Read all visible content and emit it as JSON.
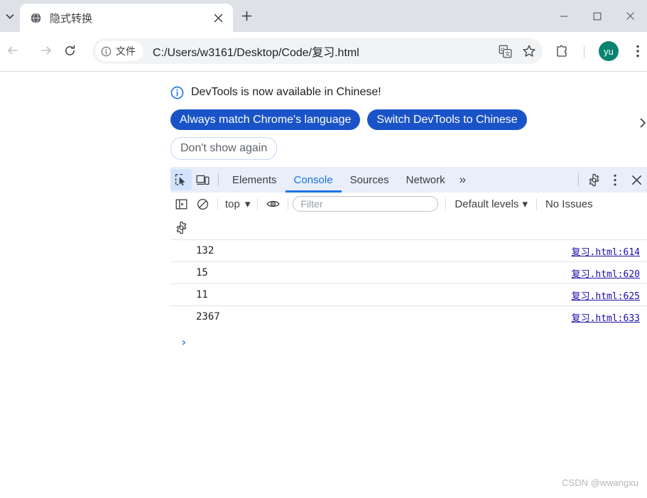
{
  "window": {
    "tab_search_icon": "chevron-down-icon",
    "minimize_label": "—",
    "maximize_label": "▢",
    "close_label": "✕"
  },
  "tab": {
    "title": "隐式转换",
    "favicon": "globe-icon",
    "close_icon": "close-icon",
    "new_tab_icon": "plus-icon"
  },
  "toolbar": {
    "back_icon": "arrow-left-icon",
    "forward_icon": "arrow-right-icon",
    "reload_icon": "reload-icon",
    "file_chip_label": "文件",
    "file_chip_icon": "info-circle-icon",
    "url": "C:/Users/w3161/Desktop/Code/复习.html",
    "translate_icon": "translate-icon",
    "bookmark_icon": "star-icon",
    "extensions_icon": "puzzle-icon",
    "avatar_initials": "yu",
    "avatar_color": "#0a8270",
    "menu_icon": "three-dot-menu-icon"
  },
  "notice": {
    "icon": "info-circle-icon",
    "message": "DevTools is now available in Chinese!",
    "primary_buttons": [
      "Always match Chrome's language",
      "Switch DevTools to Chinese"
    ],
    "secondary_button": "Don't show again",
    "more_icon": "chevron-right-icon",
    "primary_color": "#1a53c8"
  },
  "devtools": {
    "inspect_icon": "inspect-cursor-icon",
    "device_toolbar_icon": "device-toolbar-icon",
    "tabs": [
      {
        "label": "Elements",
        "active": false
      },
      {
        "label": "Console",
        "active": true
      },
      {
        "label": "Sources",
        "active": false
      },
      {
        "label": "Network",
        "active": false
      }
    ],
    "overflow_label": "»",
    "settings_icon": "gear-icon",
    "more_options_icon": "three-dot-menu-icon",
    "close_icon": "close-icon",
    "active_tab_color": "#1a73e8",
    "console_toolbar": {
      "sidebar_icon": "console-sidebar-icon",
      "clear_icon": "clear-console-icon",
      "context": "top",
      "context_caret": "▾",
      "eye_icon": "live-expression-eye-icon",
      "filter_placeholder": "Filter",
      "filter_value": "",
      "levels_label": "Default levels",
      "levels_caret": "▾",
      "issues_label": "No Issues",
      "settings_icon": "gear-icon"
    },
    "console_rows": [
      {
        "message": "132",
        "source": "复习.html:614"
      },
      {
        "message": "15",
        "source": "复习.html:620"
      },
      {
        "message": "11",
        "source": "复习.html:625"
      },
      {
        "message": "2367",
        "source": "复习.html:633"
      }
    ],
    "prompt_symbol": "›"
  },
  "watermark": "CSDN @wwangxu"
}
